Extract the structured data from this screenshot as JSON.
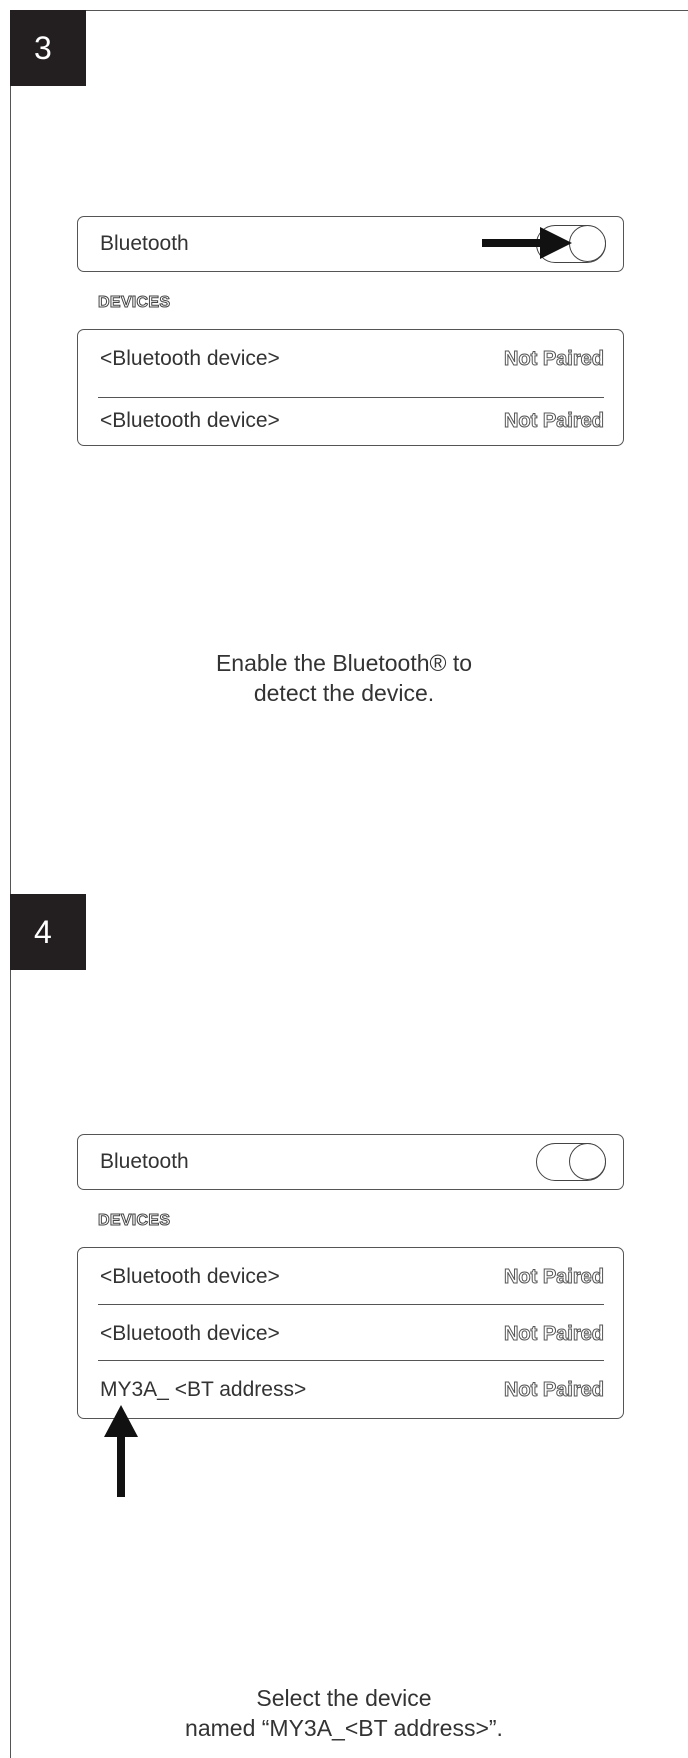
{
  "steps": [
    {
      "number": "3",
      "bluetooth_label": "Bluetooth",
      "devices_heading": "DEVICES",
      "devices": [
        {
          "name": "<Bluetooth device>",
          "status": "Not Paired"
        },
        {
          "name": "<Bluetooth device>",
          "status": "Not Paired"
        }
      ],
      "caption_line1": "Enable the Bluetooth® to",
      "caption_line2": "detect the device.",
      "arrow_icon": "arrow-right-icon"
    },
    {
      "number": "4",
      "bluetooth_label": "Bluetooth",
      "devices_heading": "DEVICES",
      "devices": [
        {
          "name": "<Bluetooth device>",
          "status": "Not Paired"
        },
        {
          "name": "<Bluetooth device>",
          "status": "Not Paired"
        },
        {
          "name": "MY3A_ <BT address>",
          "status": "Not Paired"
        }
      ],
      "caption_line1": "Select the device",
      "caption_line2": "named “MY3A_<BT address>”.",
      "arrow_icon": "arrow-up-icon"
    }
  ]
}
